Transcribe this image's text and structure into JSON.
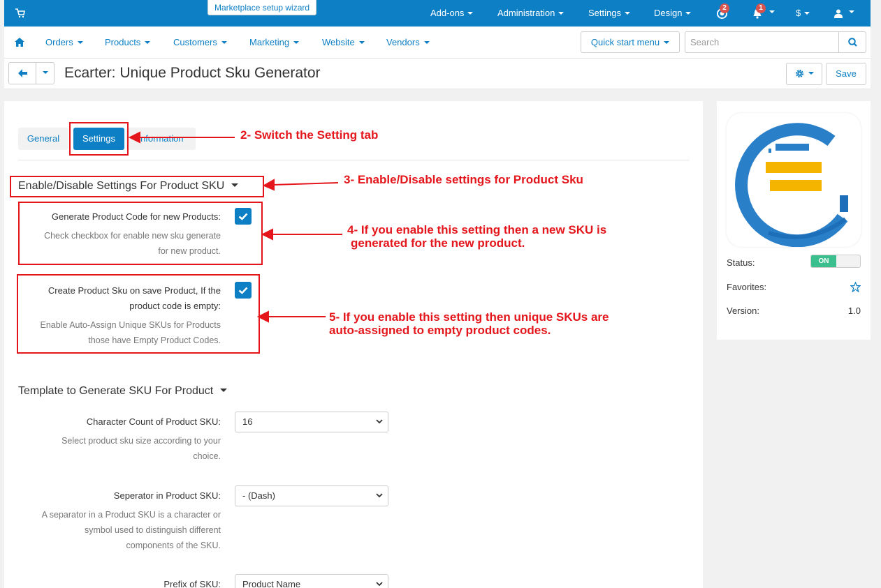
{
  "topbar": {
    "wizard_label": "Marketplace setup wizard",
    "menus": [
      "Add-ons",
      "Administration",
      "Settings",
      "Design"
    ],
    "help_badge": "2",
    "notif_badge": "1",
    "currency": "$"
  },
  "nav": {
    "items": [
      "Orders",
      "Products",
      "Customers",
      "Marketing",
      "Website",
      "Vendors"
    ],
    "quick_start": "Quick start menu",
    "search_placeholder": "Search"
  },
  "title": {
    "page_title": "Ecarter: Unique Product Sku Generator",
    "save_label": "Save"
  },
  "tabs": [
    "General",
    "Settings",
    "Information"
  ],
  "sections": {
    "enable": {
      "heading": "Enable/Disable Settings For Product SKU",
      "fields": [
        {
          "label": "Generate Product Code for new Products:",
          "help": [
            "Check checkbox for enable new sku generate",
            "for new product."
          ],
          "checked": true
        },
        {
          "label": [
            "Create Product Sku on save Product, If the",
            "product code is empty:"
          ],
          "help": [
            "Enable Auto-Assign Unique SKUs for Products",
            "those have Empty Product Codes."
          ],
          "checked": true
        }
      ]
    },
    "template": {
      "heading": "Template to Generate SKU For Product",
      "fields": [
        {
          "label": "Character Count of Product SKU:",
          "help": [
            "Select product sku size according to your",
            "choice."
          ],
          "value": "16"
        },
        {
          "label": "Seperator in Product SKU:",
          "help": [
            "A separator in a Product SKU is a character or",
            "symbol used to distinguish different",
            "components of the SKU."
          ],
          "value": "- (Dash)"
        },
        {
          "label": "Prefix of SKU:",
          "value": "Product Name"
        }
      ]
    }
  },
  "annotations": {
    "a2": "2- Switch the Setting tab",
    "a3": "3- Enable/Disable settings for Product Sku",
    "a4": [
      "4- If you enable this setting then a new SKU is",
      "generated for the new product."
    ],
    "a5": [
      "5- If you enable this setting then unique SKUs are",
      "auto-assigned to empty product codes."
    ],
    "color": "#e4161b"
  },
  "sidebar": {
    "status_label": "Status:",
    "status_value": "ON",
    "favorites_label": "Favorites:",
    "version_label": "Version:",
    "version_value": "1.0"
  },
  "colors": {
    "primary": "#0d7fc4",
    "toggle_on": "#3bbf8f",
    "badge": "#d9534f"
  }
}
